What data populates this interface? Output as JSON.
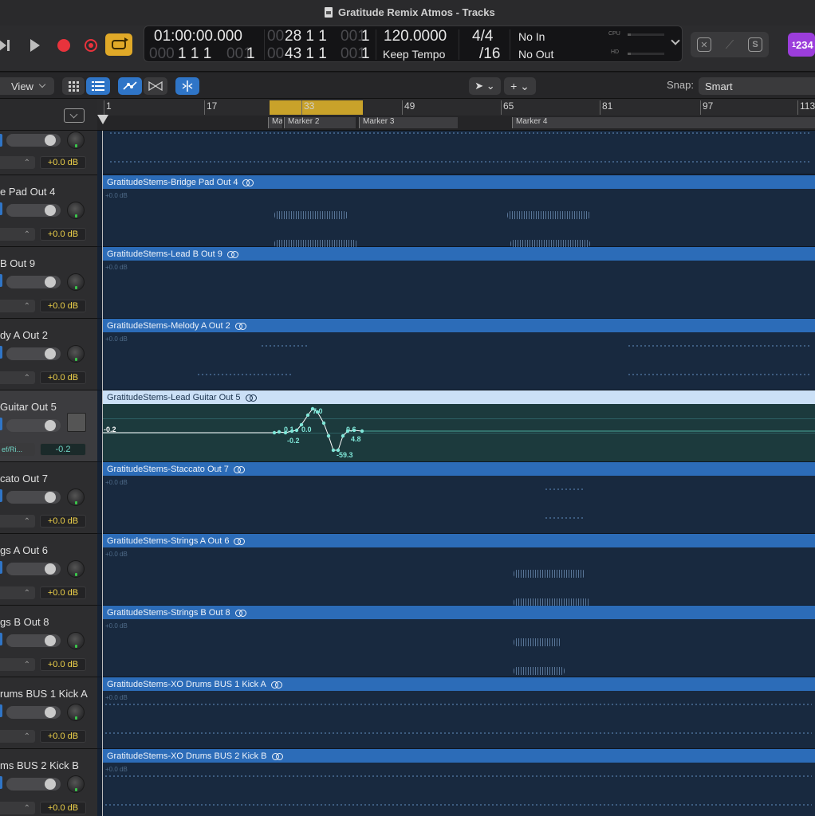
{
  "window": {
    "title": "Gratitude Remix Atmos - Tracks"
  },
  "control_bar": {
    "smpte_main": "01:00:00.000",
    "smpte_sub_dim": "000",
    "smpte_sub": "1  1  1",
    "smpte_sub_dim2": "001",
    "left_locator_dim": "00",
    "left_locator": "28  1  1",
    "left_locator_dim2": "001",
    "right_locator_dim": "00",
    "right_locator": "43  1  1",
    "right_locator_dim2": "001",
    "tempo": "120.0000",
    "tempo_mode": "Keep Tempo",
    "time_signature": "4/4",
    "division": "/16",
    "midi_in": "No In",
    "midi_out": "No Out",
    "cpu_label": "CPU",
    "hd_label": "HD",
    "count_in": "1234"
  },
  "toolbar": {
    "view_label": "View",
    "snap_label": "Snap:",
    "snap_value": "Smart"
  },
  "ruler": {
    "bars": [
      "1",
      "17",
      "33",
      "49",
      "65",
      "81",
      "97",
      "113"
    ],
    "markers": [
      "Ma",
      "Marker 2",
      "Marker 3",
      "Marker 4"
    ]
  },
  "tracks": [
    {
      "name": "e Pad Out 4",
      "volume": "+0.0 dB"
    },
    {
      "name": "B Out 9",
      "volume": "+0.0 dB"
    },
    {
      "name": "dy A Out 2",
      "volume": "+0.0 dB"
    },
    {
      "name": "Guitar Out 5",
      "volume": "-0.2",
      "send": "ef/Ri..."
    },
    {
      "name": "cato Out 7",
      "volume": "+0.0 dB"
    },
    {
      "name": "gs A Out 6",
      "volume": "+0.0 dB"
    },
    {
      "name": "gs B Out 8",
      "volume": "+0.0 dB"
    },
    {
      "name": "rums BUS 1 Kick A",
      "volume": "+0.0 dB"
    },
    {
      "name": "ms BUS 2 Kick B",
      "volume": "+0.0 dB"
    }
  ],
  "top_track": {
    "volume": "+0.0 dB"
  },
  "regions": [
    {
      "name": "GratitudeStems-Bridge Pad Out 4",
      "db": "+0.0 dB"
    },
    {
      "name": "GratitudeStems-Lead B Out 9",
      "db": "+0.0 dB"
    },
    {
      "name": "GratitudeStems-Melody A Out 2",
      "db": "+0.0 dB"
    },
    {
      "name": "GratitudeStems-Lead Guitar Out 5",
      "db": ""
    },
    {
      "name": "GratitudeStems-Staccato Out 7",
      "db": "+0.0 dB"
    },
    {
      "name": "GratitudeStems-Strings A Out 6",
      "db": "+0.0 dB"
    },
    {
      "name": "GratitudeStems-Strings B Out 8",
      "db": "+0.0 dB"
    },
    {
      "name": "GratitudeStems-XO Drums BUS 1 Kick A",
      "db": "+0.0 dB"
    },
    {
      "name": "GratitudeStems-XO Drums BUS 2 Kick B",
      "db": "+0.0 dB"
    }
  ],
  "automation": {
    "labels": {
      "start": "-0.2",
      "a": "0.1",
      "b": "0.0",
      "c": "-0.2",
      "peak": "7.0",
      "trough": "-59.3",
      "d": "0.6",
      "e": "4.8"
    }
  },
  "colors": {
    "region_blue": "#2c6cb8",
    "cycle_yellow": "#c9a22a",
    "record_red": "#e8333c",
    "automation_cyan": "#7fe6d8"
  }
}
